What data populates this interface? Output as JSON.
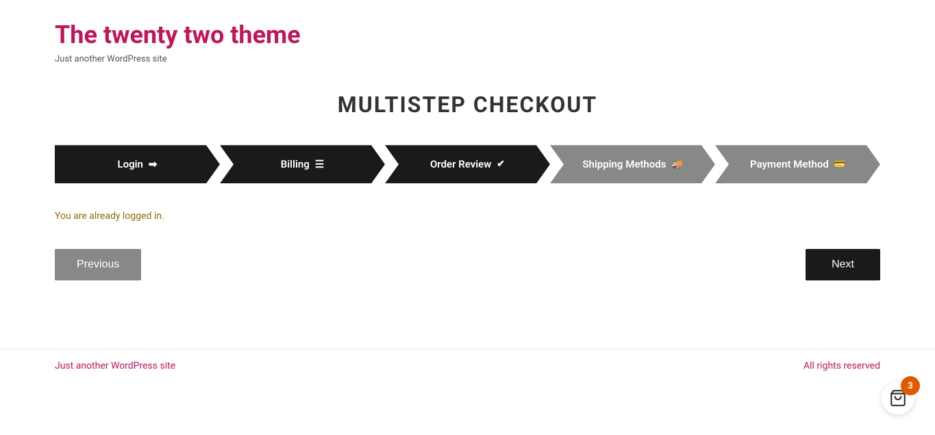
{
  "header": {
    "site_title": "The twenty two theme",
    "site_tagline": "Just another WordPress site"
  },
  "main": {
    "checkout_title": "MULTISTEP CHECKOUT",
    "steps": [
      {
        "id": "login",
        "label": "Login",
        "icon": "→",
        "state": "active"
      },
      {
        "id": "billing",
        "label": "Billing",
        "icon": "☰",
        "state": "active"
      },
      {
        "id": "order-review",
        "label": "Order Review",
        "icon": "✔",
        "state": "active"
      },
      {
        "id": "shipping-methods",
        "label": "Shipping Methods",
        "icon": "🚚",
        "state": "inactive"
      },
      {
        "id": "payment-method",
        "label": "Payment Method",
        "icon": "💳",
        "state": "inactive"
      }
    ],
    "logged_in_message": "You are already logged in.",
    "btn_previous": "Previous",
    "btn_next": "Next"
  },
  "footer": {
    "left_text": "Just another WordPress site",
    "right_text": "All rights reserved"
  },
  "cart": {
    "count": "3"
  }
}
